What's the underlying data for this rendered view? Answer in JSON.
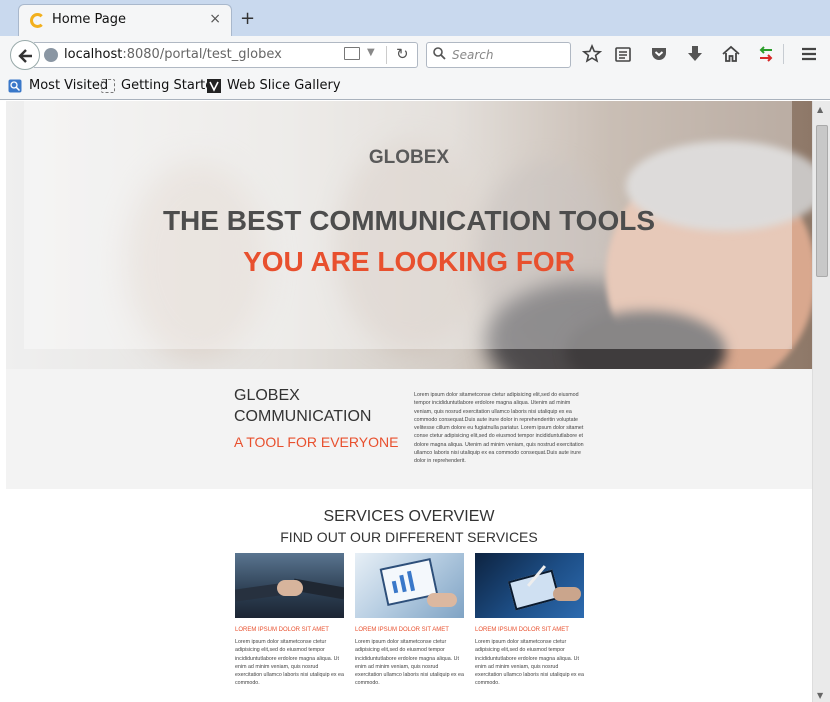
{
  "browser": {
    "tab_title": "Home Page",
    "tab_close": "×",
    "new_tab": "+",
    "url_host": "localhost",
    "url_rest": ":8080/portal/test_globex",
    "search_placeholder": "Search",
    "bookmarks": [
      "Most Visited",
      "Getting Started",
      "Web Slice Gallery"
    ]
  },
  "hero": {
    "brand": "GLOBEX",
    "line1": "THE BEST COMMUNICATION TOOLS",
    "line2": "YOU ARE LOOKING FOR"
  },
  "about": {
    "title_line1": "GLOBEX",
    "title_line2": "COMMUNICATION",
    "subtitle": "A TOOL FOR EVERYONE",
    "body": "Lorem ipsum dolor sitametconse ctetur adipisicing elit,sed do eiusmod tempor incididuntutlabore erdolore magna aliqua. Utenim ad minim veniam, quis nosrud exercitation ullamco laboris nisi utaliquip ex ea commodo consequat.Duis aute irure dolor in reprehenderitin voluptate velitesse cillum dolore eu fugiatnulla pariatur. Lorem ipsum dolor sitamet conse ctetur adipisicing elit,sed do eiusmod tempor incididuntutlabore et dolore magna aliqua. Utenim ad minim veniam, quis nostrud exercitation ullamco laboris nisi utaliquip ex ea commodo consequat.Duis aute irure dolor in reprehenderit."
  },
  "services": {
    "title": "SERVICES OVERVIEW",
    "subtitle": "FIND OUT OUR DIFFERENT SERVICES",
    "cards": [
      {
        "heading": "LOREM IPSUM DOLOR SIT AMET",
        "body": "Lorem ipsum dolor sitametconse ctetur adipisicing elit,sed do eiusmod tempor incididuntutlabore erdolore magna aliqua. Ut enim ad minim veniam, quis nosrud exercitation ullamco laboris nisi utaliquip ex ea commodo."
      },
      {
        "heading": "LOREM IPSUM DOLOR SIT AMET",
        "body": "Lorem ipsum dolor sitametconse ctetur adipisicing elit,sed do eiusmod tempor incididuntutlabore erdolore magna aliqua. Ut enim ad minim veniam, quis nosrud exercitation ullamco laboris nisi utaliquip ex ea commodo."
      },
      {
        "heading": "LOREM IPSUM DOLOR SIT AMET",
        "body": "Lorem ipsum dolor sitametconse ctetur adipisicing elit,sed do eiusmod tempor incididuntutlabore erdolore magna aliqua. Ut enim ad minim veniam, quis nosrud exercitation ullamco laboris nisi utaliquip ex ea commodo."
      }
    ]
  },
  "colors": {
    "accent": "#e8502e",
    "heading_gray": "#4d4d4d",
    "chrome_blue": "#c9d9ee"
  },
  "icons": [
    "back-arrow-icon",
    "globe-icon",
    "reader-view-icon",
    "reload-icon",
    "search-icon",
    "bookmark-star-icon",
    "reading-list-icon",
    "pocket-icon",
    "download-icon",
    "home-icon",
    "sync-arrows-icon",
    "hamburger-menu-icon"
  ]
}
